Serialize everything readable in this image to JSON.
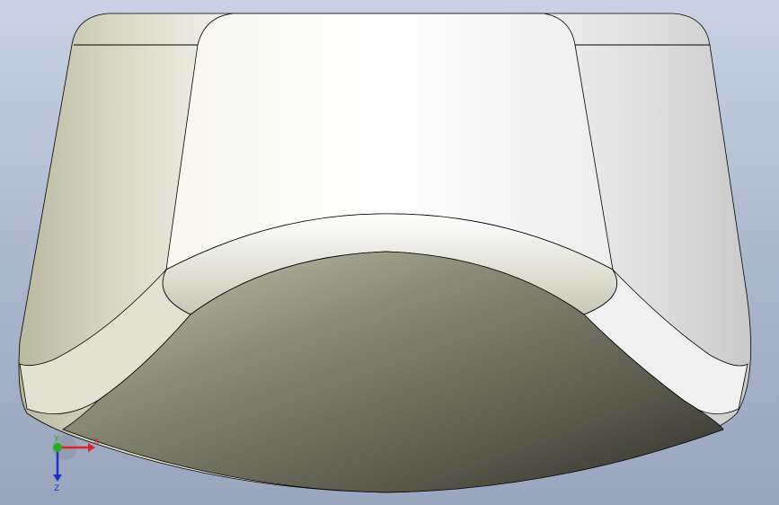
{
  "viewport": {
    "background_top": "#c9d2e4",
    "background_bottom": "#9aa6bd"
  },
  "model": {
    "top_face_color": "#ffffff",
    "left_face_color": "#c9c8b4",
    "right_face_color": "#dcdcdc",
    "bottom_face_color": "#8b8b78",
    "edge_color": "#000000"
  },
  "triad": {
    "x_label": "X",
    "y_label": "Y",
    "z_label": "Z",
    "x_color": "#e0202a",
    "y_color": "#22b022",
    "z_color": "#2030c8"
  }
}
